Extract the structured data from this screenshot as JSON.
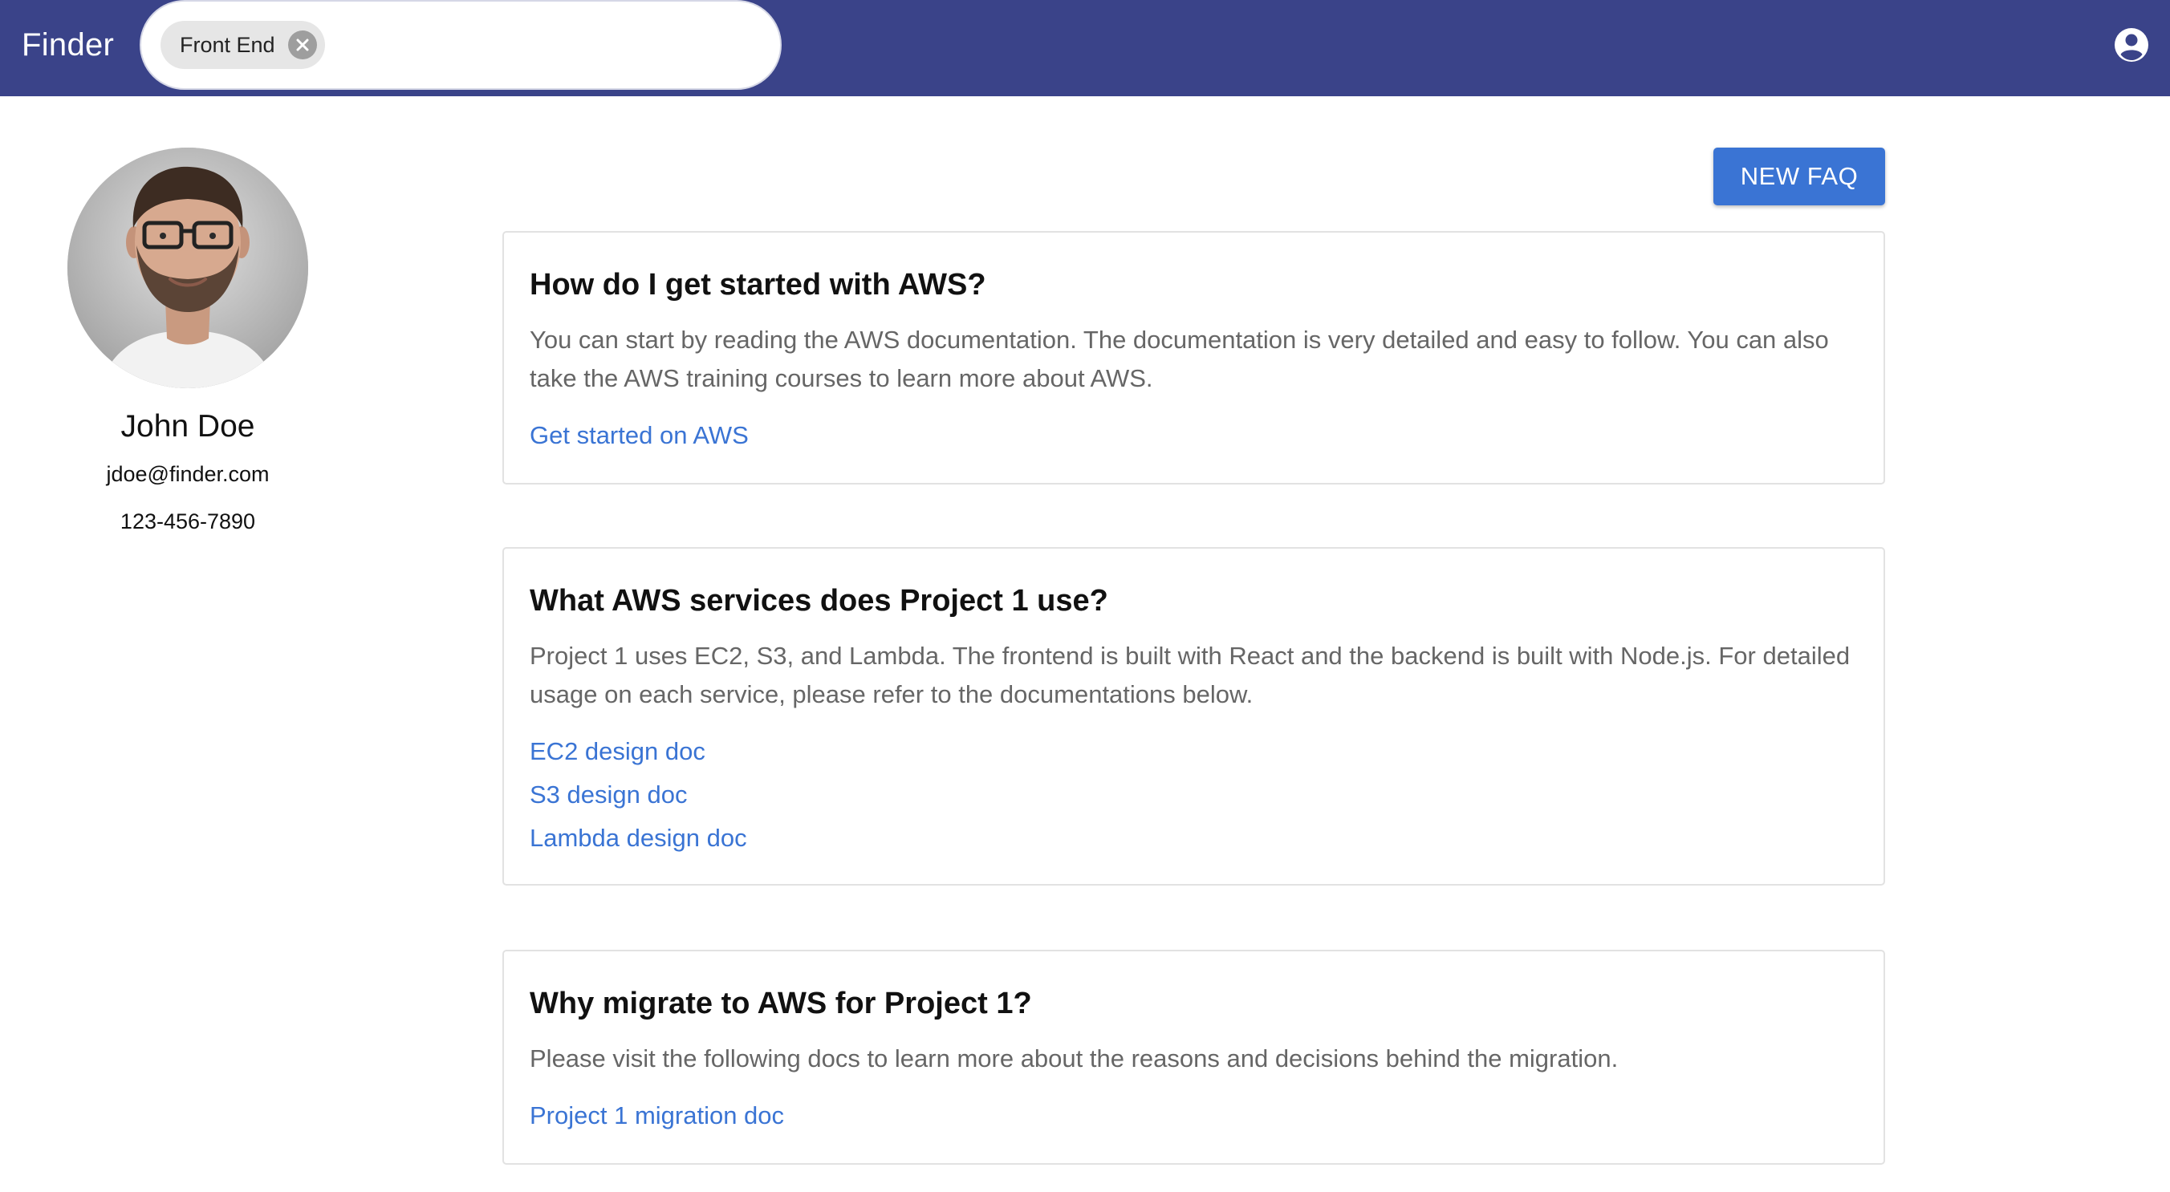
{
  "header": {
    "app_title": "Finder",
    "search": {
      "chip_label": "Front End",
      "input_value": ""
    },
    "account_icon": "account-circle-icon"
  },
  "profile": {
    "name": "John Doe",
    "email": "jdoe@finder.com",
    "phone": "123-456-7890"
  },
  "toolbar": {
    "new_faq_label": "NEW FAQ"
  },
  "faqs": [
    {
      "question": "How do I get started with AWS?",
      "answer": "You can start by reading the AWS documentation. The documentation is very detailed and easy to follow. You can also take the AWS training courses to learn more about AWS.",
      "links": [
        "Get started on AWS"
      ]
    },
    {
      "question": "What AWS services does Project 1 use?",
      "answer": "Project 1 uses EC2, S3, and Lambda. The frontend is built with React and the backend is built with Node.js. For detailed usage on each service, please refer to the documentations below.",
      "links": [
        "EC2 design doc",
        "S3 design doc",
        "Lambda design doc"
      ]
    },
    {
      "question": "Why migrate to AWS for Project 1?",
      "answer": "Please visit the following docs to learn more about the reasons and decisions behind the migration.",
      "links": [
        "Project 1 migration doc"
      ]
    }
  ],
  "colors": {
    "appbar": "#3a4389",
    "primary": "#3a74d4",
    "link": "#3a74d4",
    "answer_text": "#666666"
  }
}
